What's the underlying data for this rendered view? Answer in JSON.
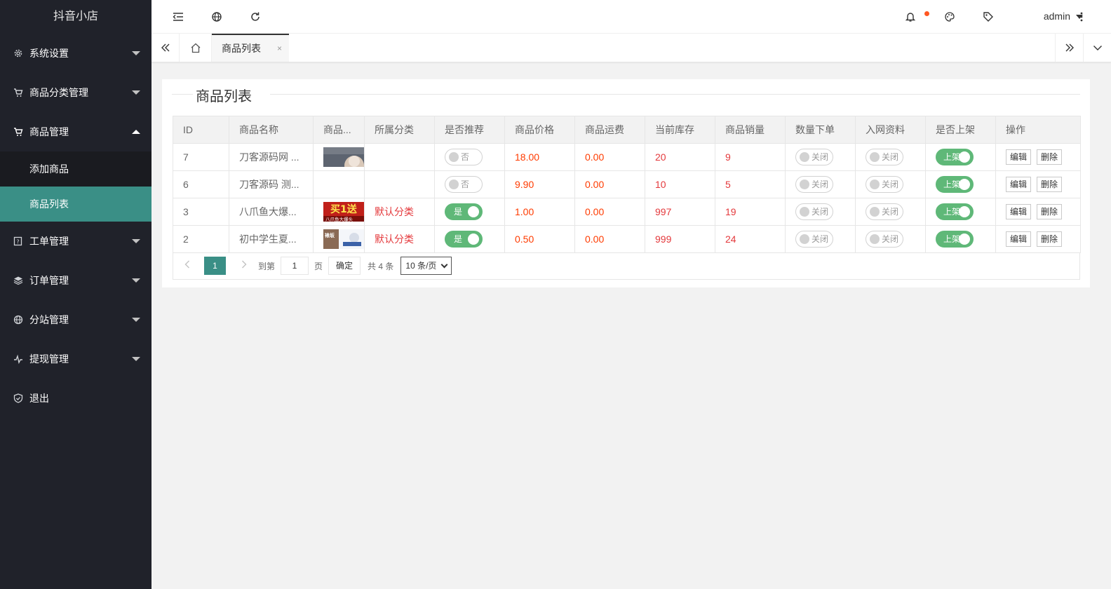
{
  "sidebar": {
    "logo": "抖音小店",
    "items": [
      {
        "label": "系统设置",
        "icon": "gear-icon"
      },
      {
        "label": "商品分类管理",
        "icon": "cart-icon"
      },
      {
        "label": "商品管理",
        "icon": "cart-icon",
        "expanded": true
      },
      {
        "label": "工单管理",
        "icon": "help-doc-icon"
      },
      {
        "label": "订单管理",
        "icon": "layers-icon"
      },
      {
        "label": "分站管理",
        "icon": "globe-icon"
      },
      {
        "label": "提现管理",
        "icon": "pulse-icon"
      },
      {
        "label": "退出",
        "icon": "shield-icon"
      }
    ],
    "sub_items": [
      {
        "label": "添加商品"
      },
      {
        "label": "商品列表",
        "active": true
      }
    ]
  },
  "header": {
    "user": "admin",
    "icons": [
      "menu-fold-icon",
      "globe-icon",
      "refresh-icon",
      "bell-icon",
      "palette-icon",
      "tag-icon",
      "more-icon"
    ]
  },
  "tabs": {
    "active_label": "商品列表",
    "close_glyph": "×"
  },
  "card": {
    "title": "商品列表"
  },
  "table": {
    "headers": [
      "ID",
      "商品名称",
      "商品...",
      "所属分类",
      "是否推荐",
      "商品价格",
      "商品运费",
      "当前库存",
      "商品销量",
      "数量下单",
      "入网资料",
      "是否上架",
      "操作"
    ],
    "rows": [
      {
        "id": "7",
        "name": "刀客源码网 ...",
        "category": "",
        "recommend": "否",
        "recommend_on": false,
        "price": "18.00",
        "shipping": "0.00",
        "stock": "20",
        "sales": "9",
        "qty_order": "关闭",
        "net_info": "关闭",
        "listed": "上架",
        "thumb": "portrait"
      },
      {
        "id": "6",
        "name": "刀客源码 测...",
        "category": "",
        "recommend": "否",
        "recommend_on": false,
        "price": "9.90",
        "shipping": "0.00",
        "stock": "10",
        "sales": "5",
        "qty_order": "关闭",
        "net_info": "关闭",
        "listed": "上架",
        "thumb": "blank"
      },
      {
        "id": "3",
        "name": "八爪鱼大爆...",
        "category": "默认分类",
        "recommend": "是",
        "recommend_on": true,
        "price": "1.00",
        "shipping": "0.00",
        "stock": "997",
        "sales": "19",
        "qty_order": "关闭",
        "net_info": "关闭",
        "listed": "上架",
        "thumb": "promo",
        "thumb_text": "买1送",
        "thumb_sub": "八爪鱼大爆头"
      },
      {
        "id": "2",
        "name": "初中学生夏...",
        "category": "默认分类",
        "recommend": "是",
        "recommend_on": true,
        "price": "0.50",
        "shipping": "0.00",
        "stock": "999",
        "sales": "24",
        "qty_order": "关闭",
        "net_info": "关闭",
        "listed": "上架",
        "thumb": "clothes",
        "thumb_text": "裱坂"
      }
    ],
    "actions": {
      "edit": "编辑",
      "delete": "删除"
    }
  },
  "pagination": {
    "current": "1",
    "goto_label": "到第",
    "goto_value": "1",
    "page_unit": "页",
    "confirm": "确定",
    "total": "共 4 条",
    "page_size": "10 条/页"
  },
  "colors": {
    "sidebar_bg": "#20222a",
    "accent": "#3a8f86",
    "switch_on": "#5fb878",
    "price_red": "#ff3b00"
  }
}
